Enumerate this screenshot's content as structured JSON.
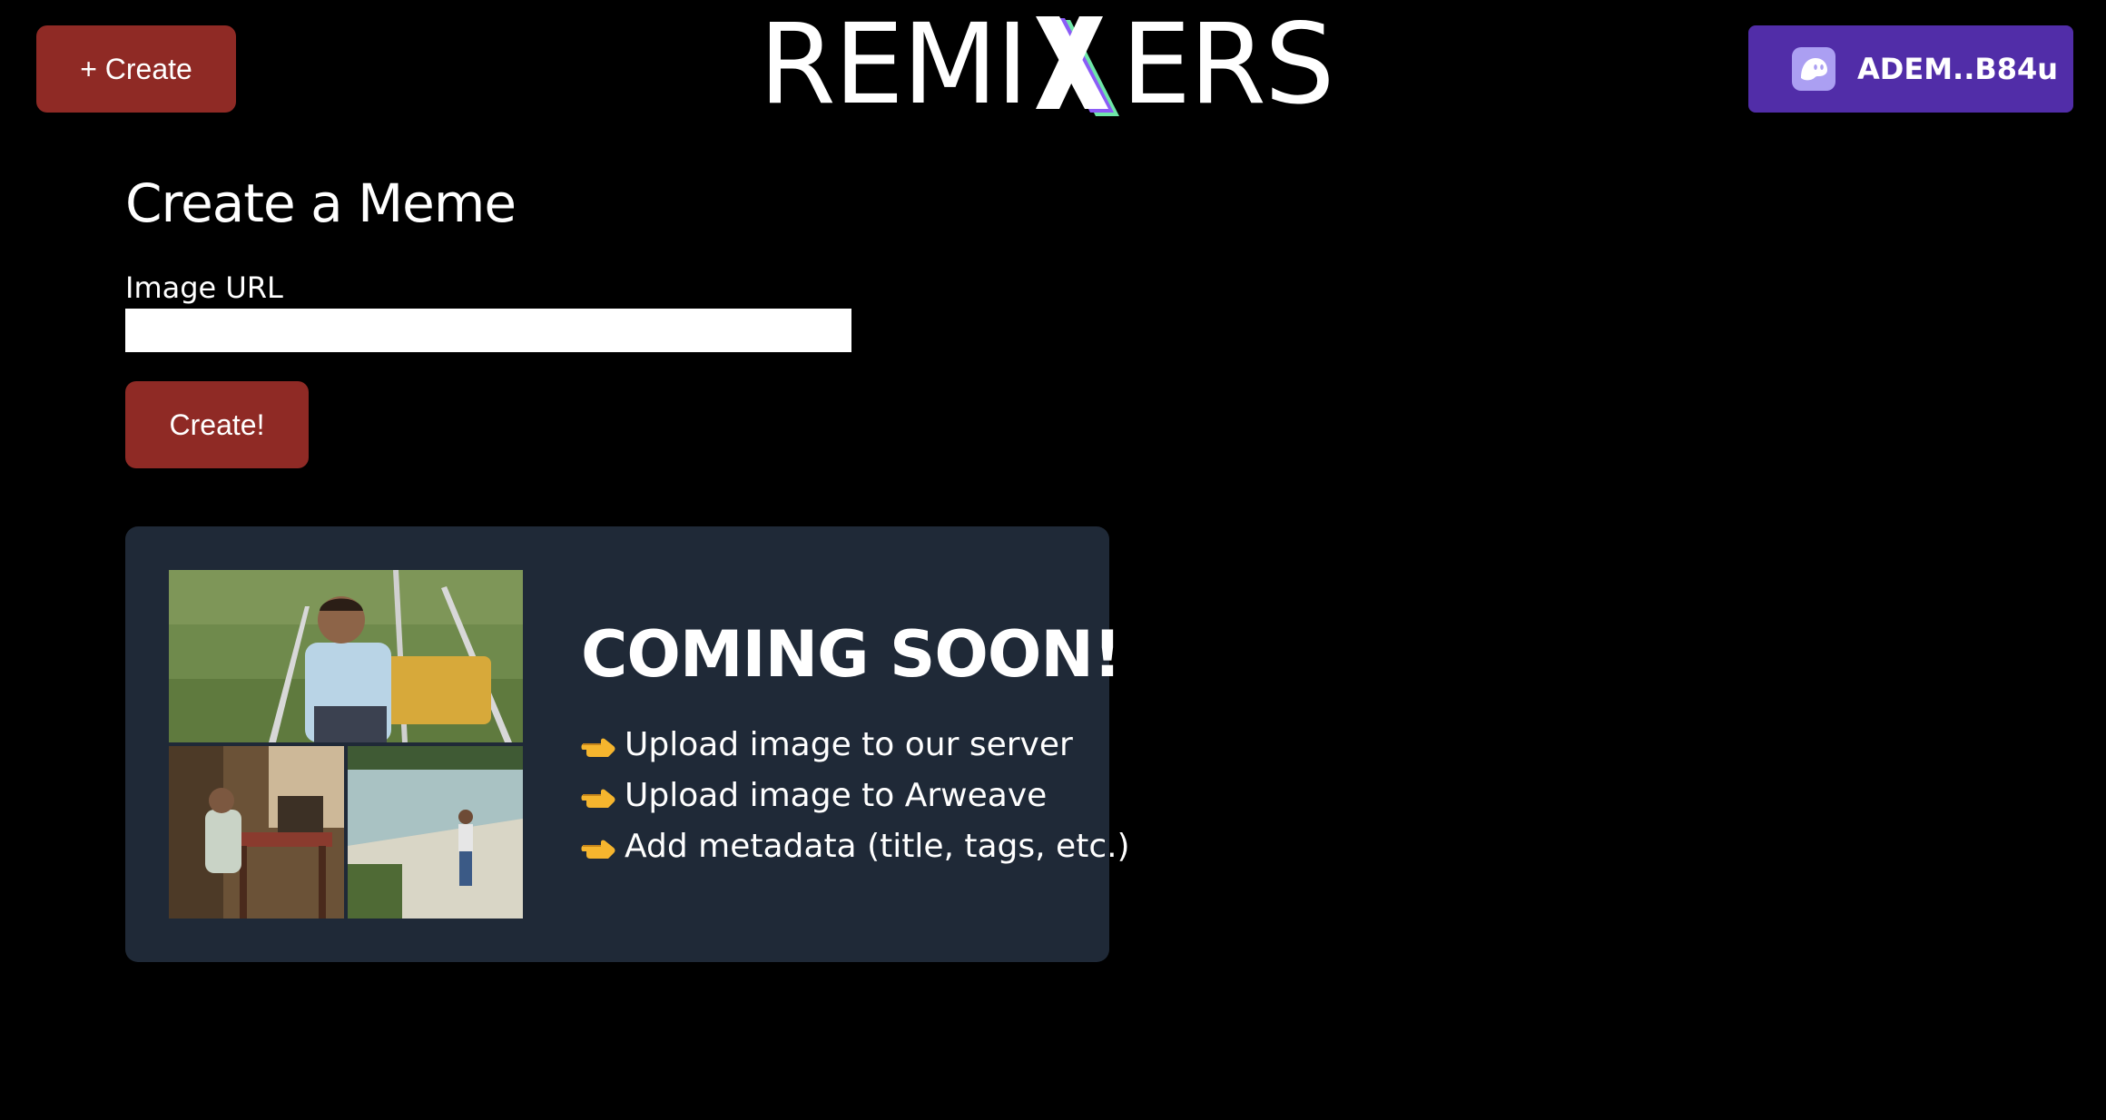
{
  "header": {
    "create_label": "+ Create",
    "logo_text_left": "REMI",
    "logo_text_right": "ERS",
    "wallet_label": "ADEM..B84u"
  },
  "form": {
    "title": "Create a Meme",
    "image_url_label": "Image URL",
    "image_url_value": "",
    "submit_label": "Create!"
  },
  "coming_soon": {
    "title": "COMING SOON!",
    "items": [
      "Upload image to our server",
      "Upload image to Arweave",
      "Add metadata (title, tags, etc.)"
    ],
    "item_icon": "pointing-hand-icon"
  },
  "colors": {
    "background": "#000000",
    "primary_red": "#8f2a25",
    "wallet_purple": "#512da8",
    "card_bg": "#1f2937",
    "logo_accent_green": "#6ee7a8",
    "logo_accent_purple": "#8b5cf6"
  }
}
